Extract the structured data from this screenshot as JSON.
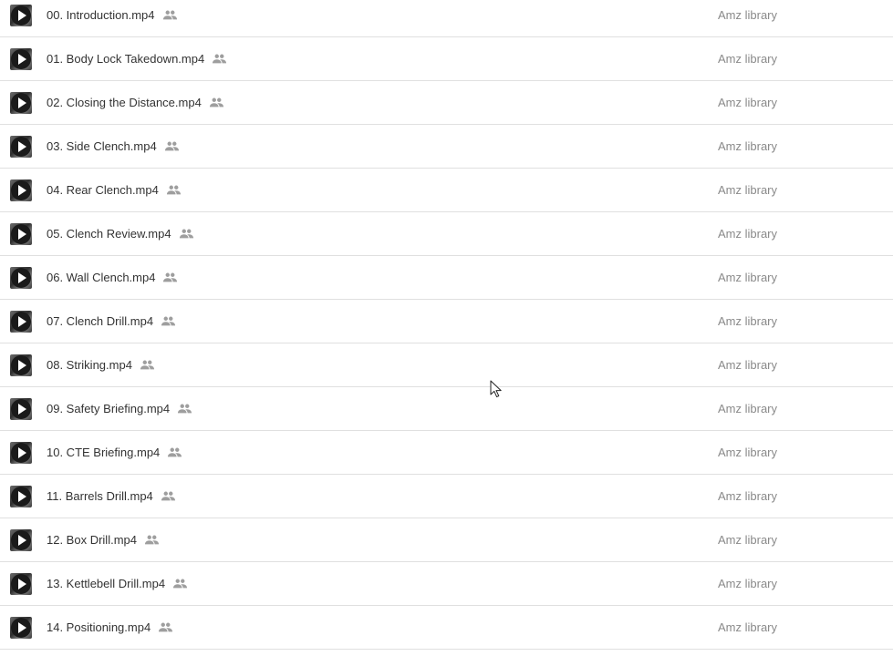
{
  "files": [
    {
      "name": "00. Introduction.mp4",
      "owner": "Amz library",
      "icon": "play-video-icon",
      "shared_icon": "people-icon"
    },
    {
      "name": "01. Body Lock Takedown.mp4",
      "owner": "Amz library",
      "icon": "play-video-icon",
      "shared_icon": "people-icon"
    },
    {
      "name": "02. Closing the Distance.mp4",
      "owner": "Amz library",
      "icon": "play-video-icon",
      "shared_icon": "people-icon"
    },
    {
      "name": "03. Side Clench.mp4",
      "owner": "Amz library",
      "icon": "play-video-icon",
      "shared_icon": "people-icon"
    },
    {
      "name": "04. Rear Clench.mp4",
      "owner": "Amz library",
      "icon": "play-video-icon",
      "shared_icon": "people-icon"
    },
    {
      "name": "05. Clench Review.mp4",
      "owner": "Amz library",
      "icon": "play-video-icon",
      "shared_icon": "people-icon"
    },
    {
      "name": "06. Wall Clench.mp4",
      "owner": "Amz library",
      "icon": "play-video-icon",
      "shared_icon": "people-icon"
    },
    {
      "name": "07. Clench Drill.mp4",
      "owner": "Amz library",
      "icon": "play-video-icon",
      "shared_icon": "people-icon"
    },
    {
      "name": "08. Striking.mp4",
      "owner": "Amz library",
      "icon": "play-video-icon",
      "shared_icon": "people-icon"
    },
    {
      "name": "09. Safety Briefing.mp4",
      "owner": "Amz library",
      "icon": "play-video-icon",
      "shared_icon": "people-icon"
    },
    {
      "name": "10. CTE Briefing.mp4",
      "owner": "Amz library",
      "icon": "play-video-icon",
      "shared_icon": "people-icon"
    },
    {
      "name": "11. Barrels Drill.mp4",
      "owner": "Amz library",
      "icon": "play-video-icon",
      "shared_icon": "people-icon"
    },
    {
      "name": "12. Box Drill.mp4",
      "owner": "Amz library",
      "icon": "play-video-icon",
      "shared_icon": "people-icon"
    },
    {
      "name": "13. Kettlebell Drill.mp4",
      "owner": "Amz library",
      "icon": "play-video-icon",
      "shared_icon": "people-icon"
    },
    {
      "name": "14. Positioning.mp4",
      "owner": "Amz library",
      "icon": "play-video-icon",
      "shared_icon": "people-icon"
    }
  ],
  "colors": {
    "file_name_text": "#333333",
    "owner_text": "#8a8a8a",
    "divider": "#e0e0e0",
    "shared_icon": "#9e9e9e",
    "background": "#ffffff"
  }
}
